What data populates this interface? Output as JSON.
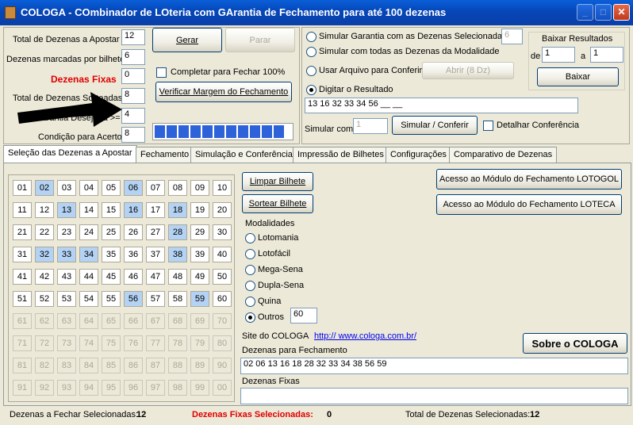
{
  "window": {
    "title": "COLOGA - COmbinador de LOteria com GArantia de Fechamento para até 100 dezenas",
    "min_icon": "minimize-icon",
    "max_icon": "maximize-icon",
    "close_icon": "close-icon"
  },
  "left_panel": {
    "total_label": "Total de Dezenas a Apostar",
    "total_value": "12",
    "per_ticket_label": "Dezenas marcadas por bilhete",
    "per_ticket_value": "6",
    "fixed_label": "Dezenas Fixas",
    "fixed_value": "0",
    "drawn_label": "Total de Dezenas Sorteadas",
    "drawn_value": "8",
    "guarantee_label": "Garantia Desejada >=",
    "guarantee_value": "4",
    "condition_label": "Condição para Acerto",
    "condition_value": "8",
    "gerar_btn": "Gerar",
    "parar_btn": "Parar",
    "complete_label": "Completar para Fechar 100%",
    "verify_btn": "Verificar Margem do Fechamento",
    "progress_blocks": 11,
    "progress": 1.0
  },
  "simulation": {
    "opt1": "Simular Garantia com as Dezenas Selecionadas",
    "opt1_value": "6",
    "opt2": "Simular com todas as Dezenas da Modalidade",
    "opt3": "Usar Arquivo para Conferir",
    "open_btn": "Abrir (8 Dz)",
    "opt4": "Digitar o Resultado",
    "result_value": "13 16 32 33 34 56 __ __",
    "simulate_label": "Simular com",
    "simulate_value": "1",
    "simulate_btn": "Simular / Conferir",
    "detail_label": "Detalhar Conferência",
    "download_title": "Baixar Resultados",
    "from_label": "de",
    "from_value": "1",
    "to_label": "a",
    "to_value": "1",
    "download_btn": "Baixar"
  },
  "tabs": [
    "Seleção das Dezenas a Apostar",
    "Fechamento",
    "Simulação e Conferência",
    "Impressão de Bilhetes",
    "Configurações",
    "Comparativo de Dezenas"
  ],
  "grid": {
    "numbers": [
      "01",
      "02",
      "03",
      "04",
      "05",
      "06",
      "07",
      "08",
      "09",
      "10",
      "11",
      "12",
      "13",
      "14",
      "15",
      "16",
      "17",
      "18",
      "19",
      "20",
      "21",
      "22",
      "23",
      "24",
      "25",
      "26",
      "27",
      "28",
      "29",
      "30",
      "31",
      "32",
      "33",
      "34",
      "35",
      "36",
      "37",
      "38",
      "39",
      "40",
      "41",
      "42",
      "43",
      "44",
      "45",
      "46",
      "47",
      "48",
      "49",
      "50",
      "51",
      "52",
      "53",
      "54",
      "55",
      "56",
      "57",
      "58",
      "59",
      "60",
      "61",
      "62",
      "63",
      "64",
      "65",
      "66",
      "67",
      "68",
      "69",
      "70",
      "71",
      "72",
      "73",
      "74",
      "75",
      "76",
      "77",
      "78",
      "79",
      "80",
      "81",
      "82",
      "83",
      "84",
      "85",
      "86",
      "87",
      "88",
      "89",
      "90",
      "91",
      "92",
      "93",
      "94",
      "95",
      "96",
      "97",
      "98",
      "99",
      "00"
    ],
    "selected": [
      "02",
      "06",
      "13",
      "16",
      "18",
      "28",
      "32",
      "33",
      "34",
      "38",
      "56",
      "59"
    ],
    "enabled_count": 60
  },
  "actions": {
    "clear_btn": "Limpar Bilhete",
    "random_btn": "Sortear Bilhete",
    "lotogol_btn": "Acesso ao Módulo do Fechamento LOTOGOL",
    "loteca_btn": "Acesso ao Módulo do Fechamento LOTECA"
  },
  "modalities": {
    "title": "Modalidades",
    "items": [
      "Lotomania",
      "Lotofácil",
      "Mega-Sena",
      "Dupla-Sena",
      "Quina",
      "Outros"
    ],
    "selected": "Outros",
    "outros_value": "60"
  },
  "site": {
    "label": "Site do COLOGA",
    "url": "http:// www.cologa.com.br/",
    "about_btn": "Sobre o COLOGA"
  },
  "closing": {
    "title": "Dezenas para Fechamento",
    "value": "02 06 13 16 18 28 32 33 34 38 56 59",
    "fixed_title": "Dezenas Fixas",
    "fixed_value": ""
  },
  "status": {
    "closing_label": "Dezenas a Fechar Selecionadas:",
    "closing_count": "12",
    "fixed_label": "Dezenas Fixas Selecionadas:",
    "fixed_count": "0",
    "total_label": "Total de Dezenas Selecionadas:",
    "total_count": "12"
  },
  "colors": {
    "title_bar": "#0a5fd8",
    "selected_cell": "#b4d3f4",
    "fixed_red": "#e00000"
  },
  "annotation": {
    "arrow_icon": "black-arrow-icon"
  }
}
